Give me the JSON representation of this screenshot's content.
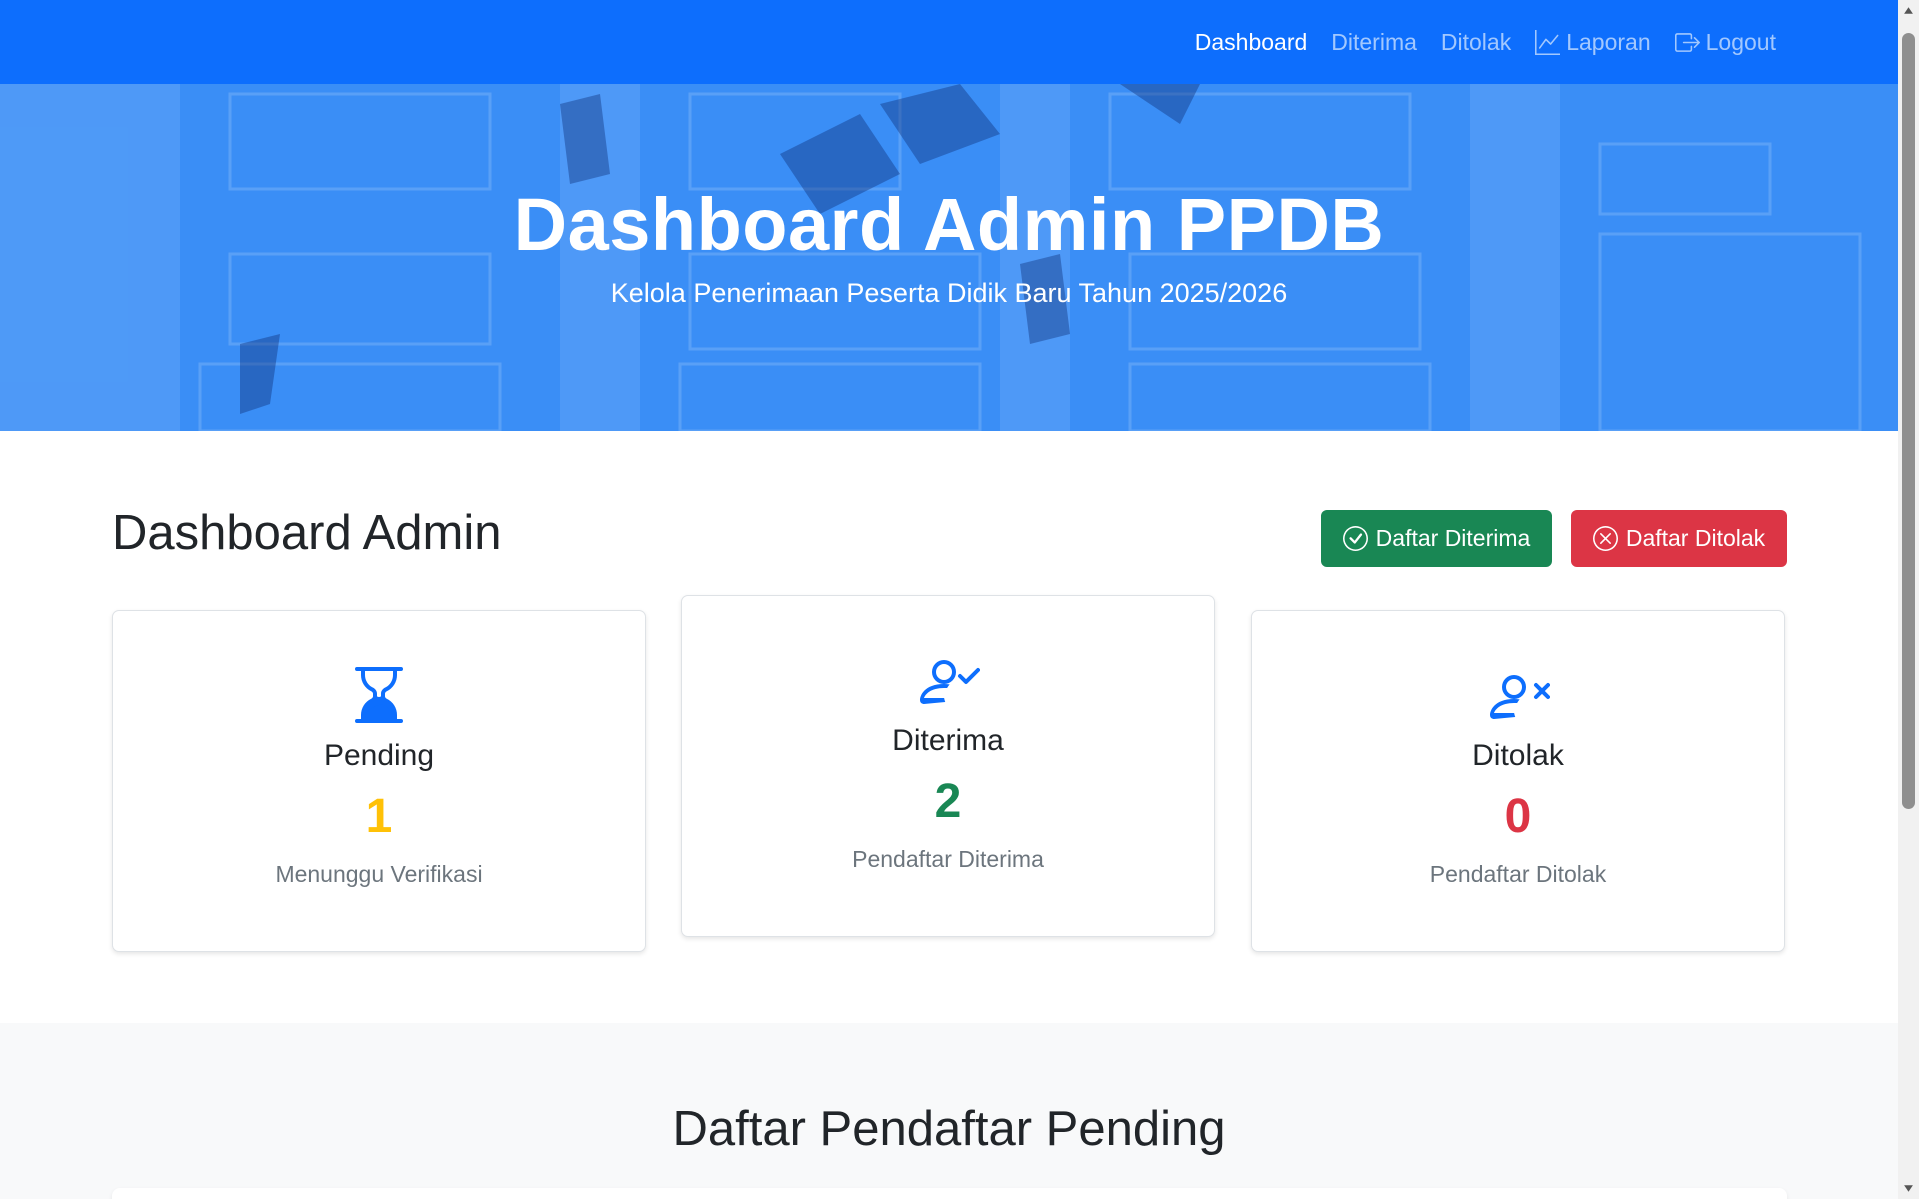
{
  "colors": {
    "primary": "#0d6efd",
    "success": "#198754",
    "danger": "#dc3545",
    "warning": "#ffc107"
  },
  "navbar": {
    "links": [
      {
        "label": "Dashboard",
        "active": true
      },
      {
        "label": "Diterima",
        "active": false
      },
      {
        "label": "Ditolak",
        "active": false
      },
      {
        "label": "Laporan",
        "icon": "graph-up-icon",
        "active": false
      },
      {
        "label": "Logout",
        "icon": "box-arrow-right-icon",
        "active": false
      }
    ]
  },
  "hero": {
    "title": "Dashboard Admin PPDB",
    "subtitle": "Kelola Penerimaan Peserta Didik Baru Tahun 2025/2026"
  },
  "main": {
    "title": "Dashboard Admin",
    "buttons": {
      "accepted": {
        "label": "Daftar Diterima",
        "icon": "check-circle-icon"
      },
      "rejected": {
        "label": "Daftar Ditolak",
        "icon": "x-circle-icon"
      }
    },
    "cards": [
      {
        "label": "Pending",
        "count": "1",
        "desc": "Menunggu Verifikasi",
        "icon": "hourglass-icon",
        "color": "#ffc107"
      },
      {
        "label": "Diterima",
        "count": "2",
        "desc": "Pendaftar Diterima",
        "icon": "person-check-icon",
        "color": "#198754"
      },
      {
        "label": "Ditolak",
        "count": "0",
        "desc": "Pendaftar Ditolak",
        "icon": "person-x-icon",
        "color": "#dc3545"
      }
    ]
  },
  "pending_section": {
    "title": "Daftar Pendaftar Pending"
  }
}
